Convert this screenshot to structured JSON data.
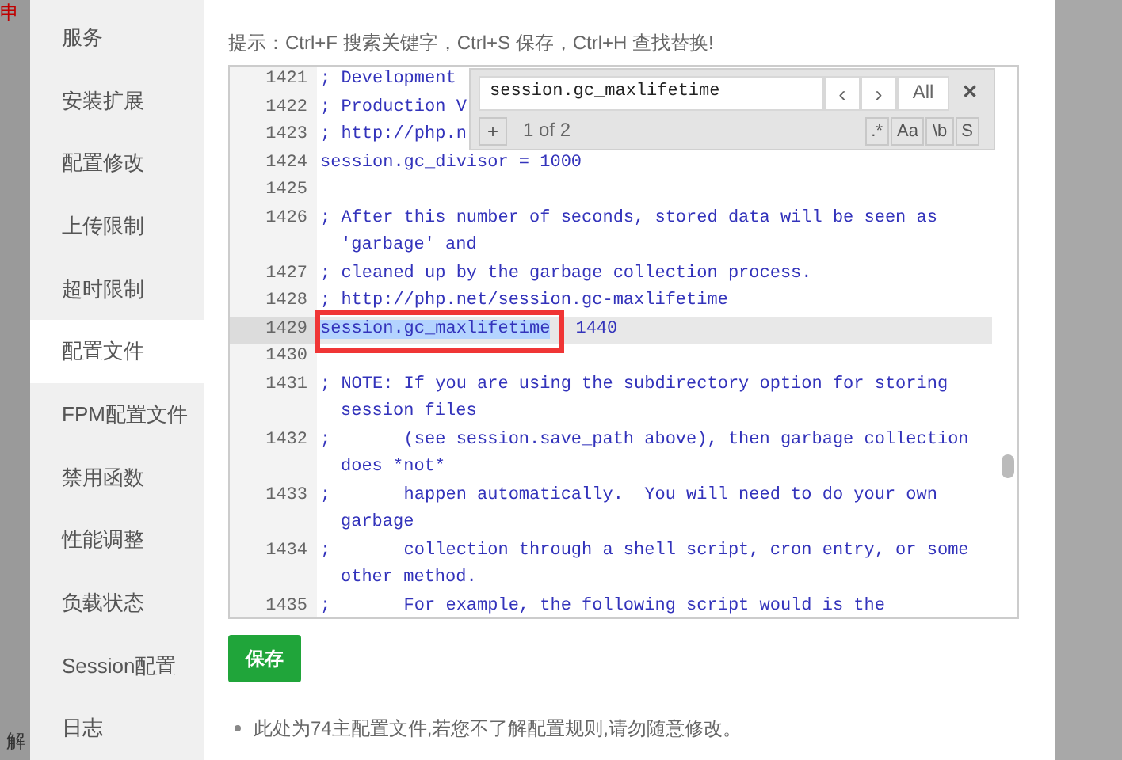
{
  "background": {
    "top_text": "申",
    "bottom_text": "解"
  },
  "sidebar": {
    "items": [
      {
        "label": "服务",
        "selected": false
      },
      {
        "label": "安装扩展",
        "selected": false
      },
      {
        "label": "配置修改",
        "selected": false
      },
      {
        "label": "上传限制",
        "selected": false
      },
      {
        "label": "超时限制",
        "selected": false
      },
      {
        "label": "配置文件",
        "selected": true
      },
      {
        "label": "FPM配置文件",
        "selected": false
      },
      {
        "label": "禁用函数",
        "selected": false
      },
      {
        "label": "性能调整",
        "selected": false
      },
      {
        "label": "负载状态",
        "selected": false
      },
      {
        "label": "Session配置",
        "selected": false
      },
      {
        "label": "日志",
        "selected": false
      }
    ]
  },
  "hint": "提示：Ctrl+F 搜索关键字，Ctrl+S 保存，Ctrl+H 查找替换!",
  "editor": {
    "lines": [
      {
        "number": "1421",
        "text": "; Development",
        "active": false
      },
      {
        "number": "1422",
        "text": "; Production V",
        "active": false
      },
      {
        "number": "1423",
        "text": "; http://php.n",
        "active": false
      },
      {
        "number": "1424",
        "text": "session.gc_divisor = 1000",
        "active": false
      },
      {
        "number": "1425",
        "active": false
      },
      {
        "number": "1426",
        "text": "; After this number of seconds, stored data will be seen as",
        "wrap": "'garbage' and",
        "active": false
      },
      {
        "number": "1427",
        "text": "; cleaned up by the garbage collection process.",
        "active": false
      },
      {
        "number": "1428",
        "text": "; http://php.net/session.gc-maxlifetime",
        "active": false
      },
      {
        "number": "1429",
        "match": "session.gc_maxlifetime",
        "text": "1440",
        "active": true
      },
      {
        "number": "1430",
        "active": false
      },
      {
        "number": "1431",
        "text": "; NOTE: If you are using the subdirectory option for storing",
        "wrap": "session files",
        "active": false
      },
      {
        "number": "1432",
        "text": ";       (see session.save_path above), then garbage collection",
        "wrap": "does *not*",
        "active": false
      },
      {
        "number": "1433",
        "text": ";       happen automatically.  You will need to do your own",
        "wrap": "garbage",
        "active": false
      },
      {
        "number": "1434",
        "text": ";       collection through a shell script, cron entry, or some",
        "wrap": "other method.",
        "active": false
      },
      {
        "number": "1435",
        "text": ";       For example, the following script would is the",
        "active": false
      }
    ],
    "search": {
      "query": "session.gc_maxlifetime",
      "prev": "‹",
      "next": "›",
      "all": "All",
      "close": "✕",
      "add": "+",
      "count": "1 of 2",
      "options": [
        {
          "label": ".*",
          "selected": false
        },
        {
          "label": "Aa",
          "selected": false
        },
        {
          "label": "\\b",
          "selected": false
        },
        {
          "label": "S",
          "selected": false
        }
      ]
    }
  },
  "save_button": "保存",
  "notes": [
    "此处为74主配置文件,若您不了解配置规则,请勿随意修改。"
  ]
}
